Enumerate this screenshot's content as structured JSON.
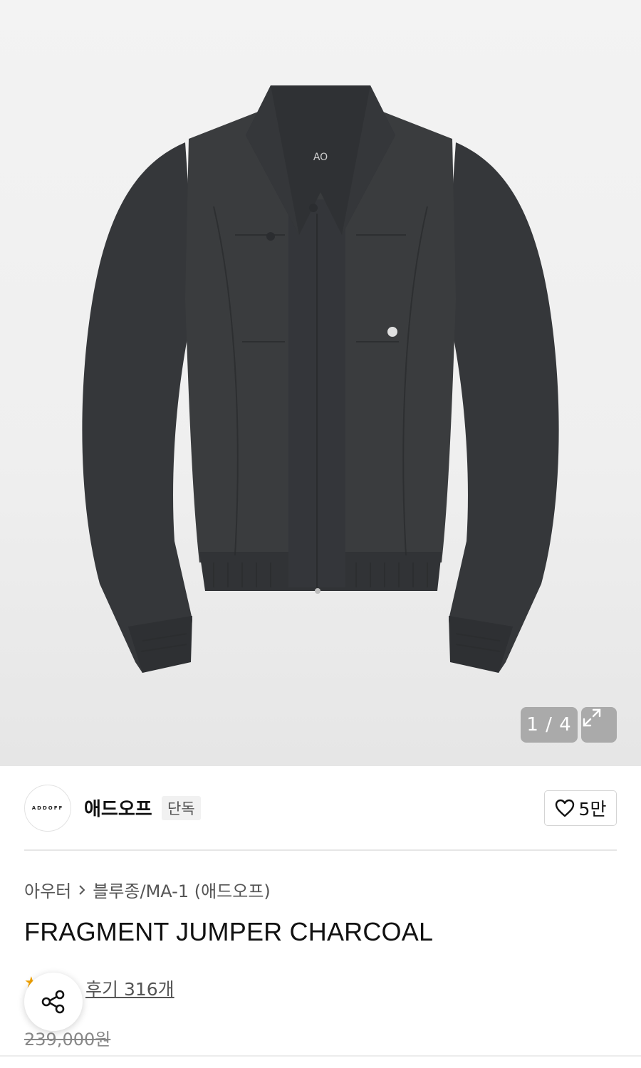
{
  "gallery": {
    "counter": "1 / 4",
    "expand_icon": "expand-icon",
    "image_alt": "product-photo"
  },
  "brand": {
    "logo_text": "ADDOFF",
    "name": "애드오프",
    "badge": "단독",
    "like_count": "5만"
  },
  "breadcrumb": {
    "category": "아우터",
    "subcategory": "블루종/MA-1 (애드오프)"
  },
  "product": {
    "title": "FRAGMENT JUMPER CHARCOAL",
    "reviews": "후기 316개",
    "original_price": "239,000원"
  },
  "colors": {
    "jacket": "#3a3c3e",
    "overlay": "#969696",
    "star": "#f2a200"
  }
}
